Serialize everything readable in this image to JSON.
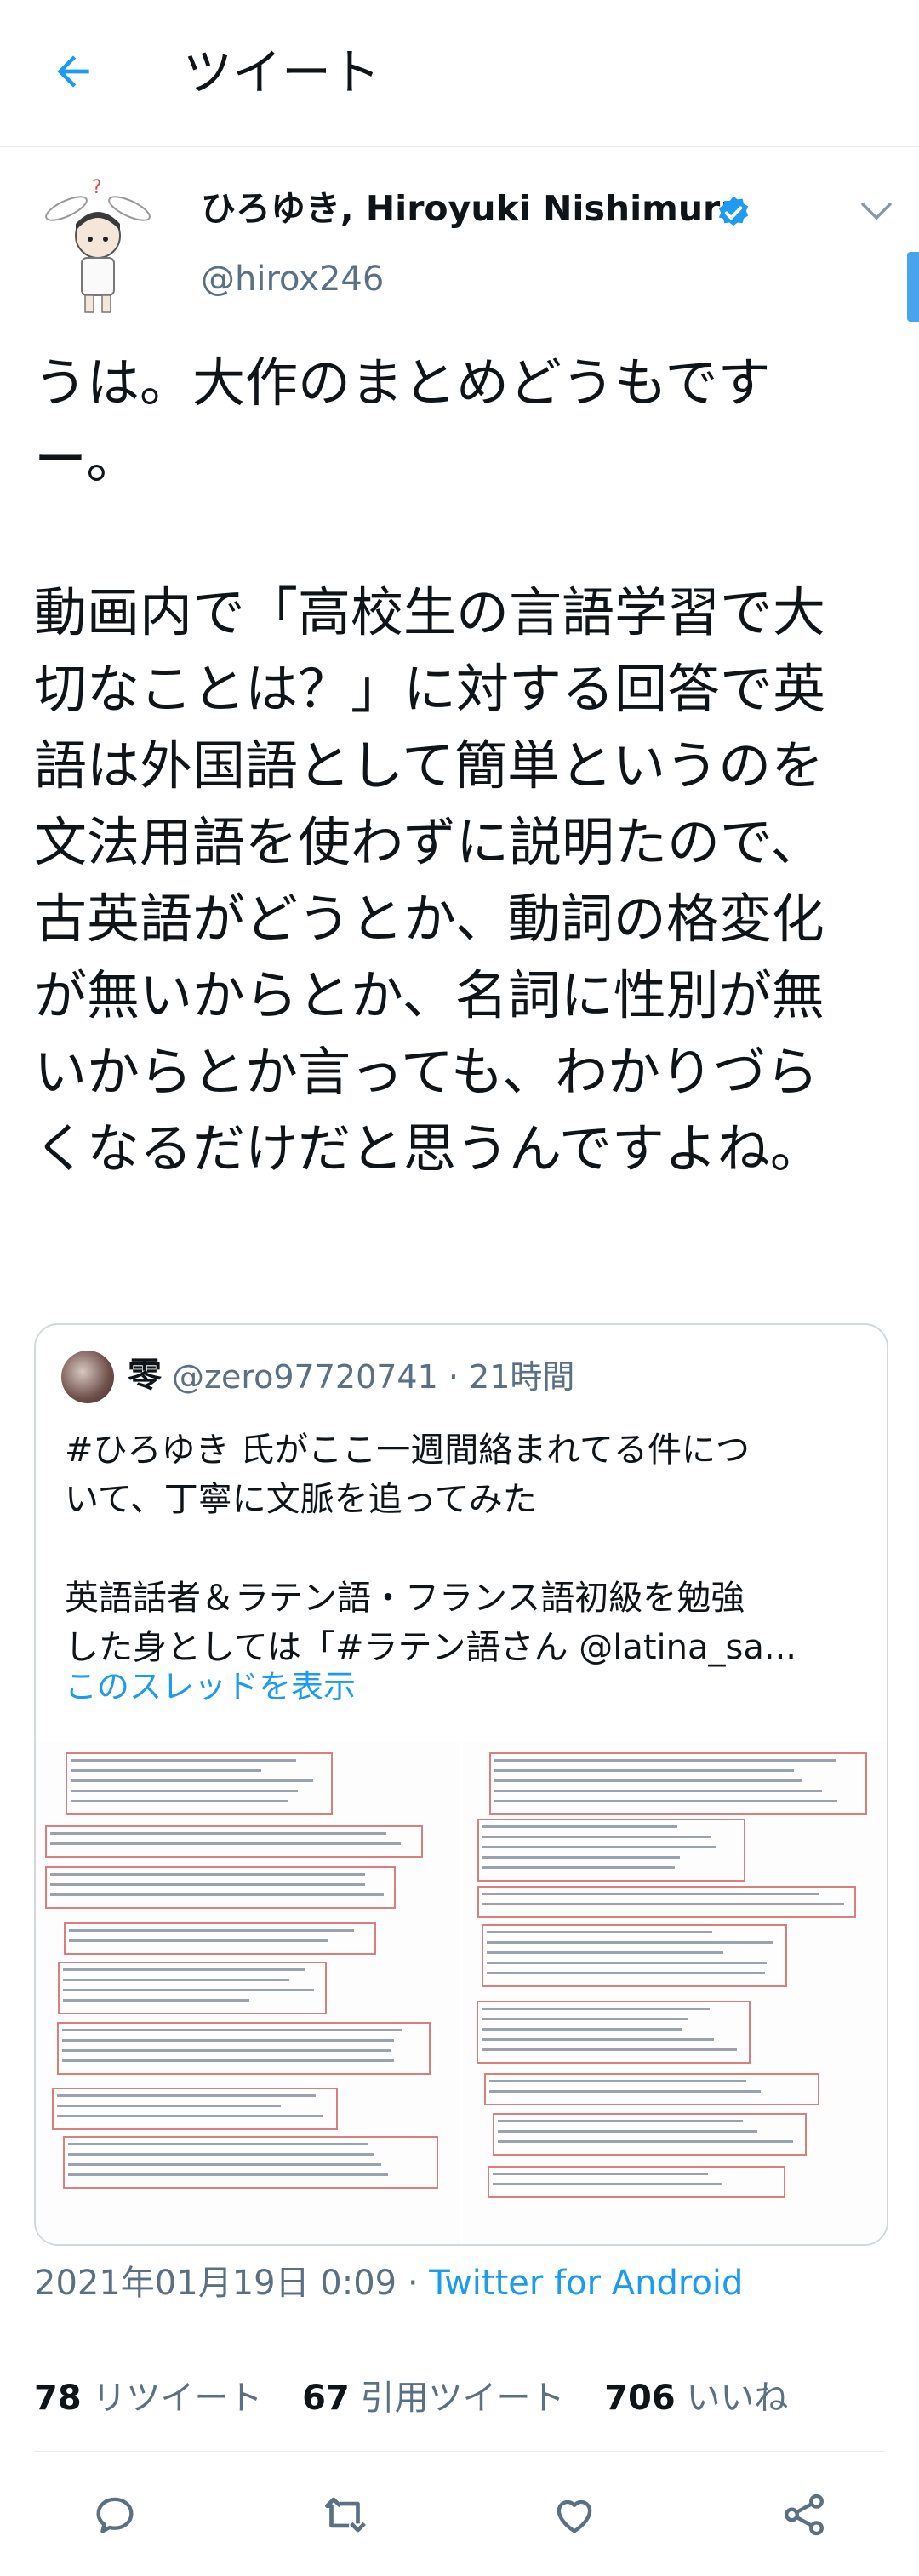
{
  "header": {
    "title": "ツイート"
  },
  "author": {
    "name": "ひろゆき, Hiroyuki Nishimura",
    "handle": "@hirox246"
  },
  "tweet": {
    "paragraph1": [
      "うは。大作のまとめどうもです",
      "ー。"
    ],
    "paragraph2": [
      "動画内で「高校生の言語学習で大",
      "切なことは？」に対する回答で英",
      "語は外国語として簡単というのを",
      "文法用語を使わずに説明たので、",
      "古英語がどうとか、動詞の格変化",
      "が無いからとか、名詞に性別が無",
      "いからとか言っても、わかりづら",
      "くなるだけだと思うんですよね。"
    ]
  },
  "quote": {
    "name": "零",
    "handle": "@zero97720741 · 21時間",
    "lines1": [
      "#ひろゆき 氏がここ一週間絡まれてる件につ",
      "いて、丁寧に文脈を追ってみた"
    ],
    "lines2": [
      "英語話者＆ラテン語・フランス語初級を勉強",
      "した身としては「#ラテン語さん @latina_sa..."
    ],
    "thread_link": "このスレッドを表示"
  },
  "meta": {
    "datetime": "2021年01月19日 0:09 · ",
    "source": "Twitter for Android"
  },
  "stats": {
    "retweets_count": "78",
    "retweets_label": "リツイート",
    "quotes_count": "67",
    "quotes_label": "引用ツイート",
    "likes_count": "706",
    "likes_label": "いいね"
  },
  "colors": {
    "accent": "#1d9bf0",
    "muted": "#5b7083",
    "border": "#cfd9de"
  },
  "icons": [
    "back-arrow-icon",
    "verified-badge-icon",
    "chevron-down-icon",
    "reply-icon",
    "retweet-icon",
    "like-icon",
    "share-icon"
  ]
}
